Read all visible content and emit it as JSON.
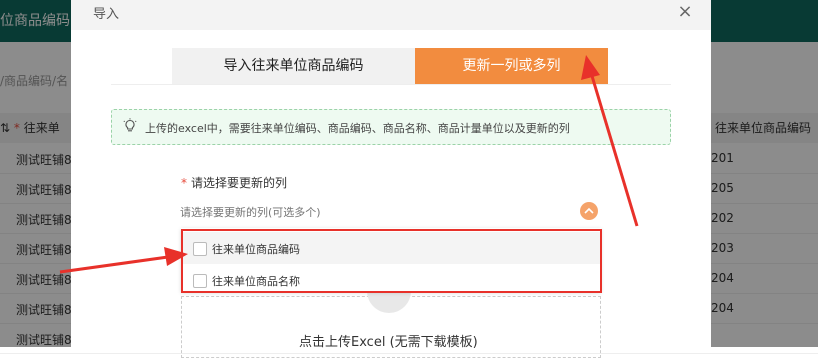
{
  "background": {
    "header_title": "位商品编码",
    "breadcrumb": "/商品编码/名",
    "table": {
      "col_left_header": "往来单",
      "col_right_header": "往来单位商品编码（",
      "rows": [
        {
          "left": "测试旺铺8",
          "right": "201"
        },
        {
          "left": "测试旺铺8",
          "right": "205"
        },
        {
          "left": "测试旺铺8",
          "right": "202"
        },
        {
          "left": "测试旺铺8",
          "right": "203"
        },
        {
          "left": "测试旺铺8",
          "right": "204"
        },
        {
          "left": "测试旺铺8",
          "right": "204"
        },
        {
          "left": "测试旺铺8",
          "right": ""
        }
      ]
    }
  },
  "modal": {
    "title": "导入",
    "close_label": "×",
    "tabs": [
      {
        "label": "导入往来单位商品编码"
      },
      {
        "label": "更新一列或多列"
      }
    ],
    "tip_text": "上传的excel中，需要往来单位编码、商品编码、商品名称、商品计量单位以及更新的列",
    "field_label": "请选择要更新的列",
    "required_mark": "*",
    "select_placeholder": "请选择要更新的列(可选多个)",
    "options": [
      {
        "label": "往来单位商品编码"
      },
      {
        "label": "往来单位商品名称"
      }
    ],
    "upload_text": "点击上传Excel (无需下载模板)"
  },
  "colors": {
    "active_tab": "#f28c3f",
    "annotation": "#e8312a"
  }
}
